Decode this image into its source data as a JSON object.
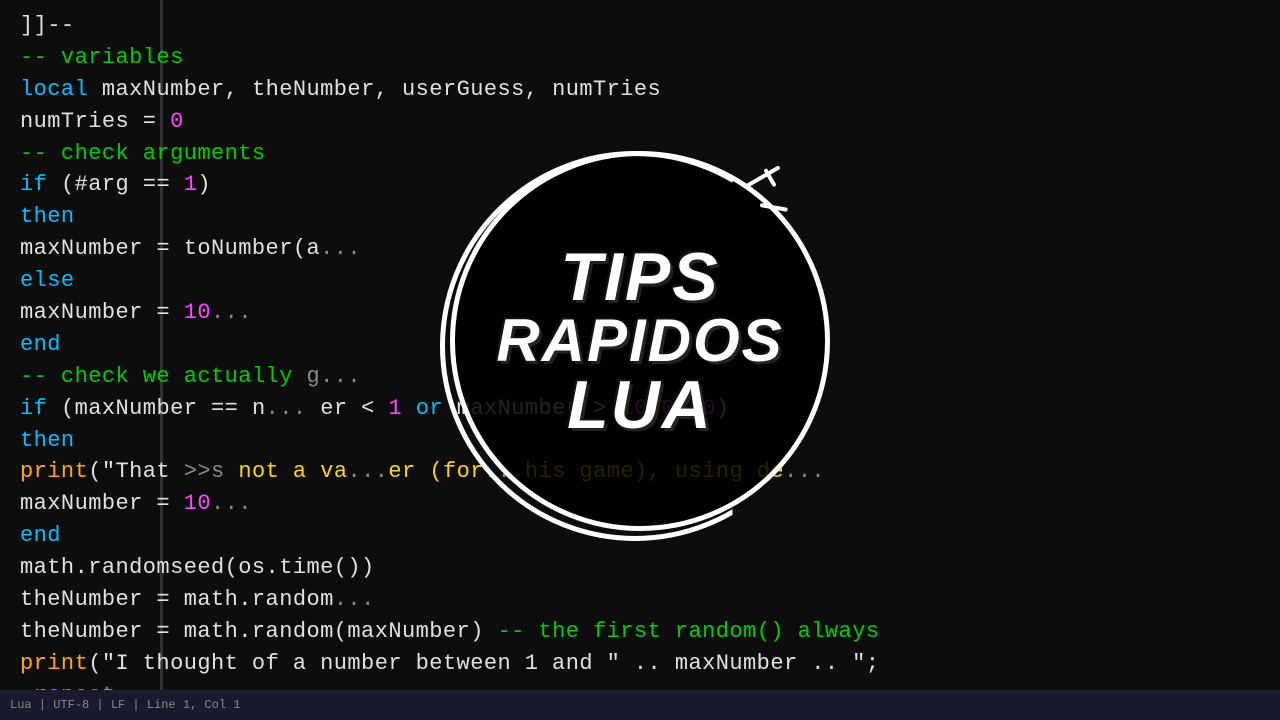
{
  "code": {
    "lines": [
      {
        "id": "l1",
        "html": "<span class='c-white'>]]--</span>"
      },
      {
        "id": "l2",
        "html": ""
      },
      {
        "id": "l3",
        "html": "<span class='c-comment'>-- variables</span>"
      },
      {
        "id": "l4",
        "html": "<span class='c-kw'>local</span> <span class='c-white'>maxNumber, theNumber, userGuess, numTries</span>"
      },
      {
        "id": "l5",
        "html": ""
      },
      {
        "id": "l6",
        "html": "<span class='c-white'>numTries</span> <span class='c-white'>=</span> <span class='c-num'>0</span>"
      },
      {
        "id": "l7",
        "html": ""
      },
      {
        "id": "l8",
        "html": "<span class='c-comment'>-- check arguments</span>"
      },
      {
        "id": "l9",
        "html": "<span class='c-kw'>if</span> <span class='c-white'>(#arg ==</span> <span class='c-num'>1</span><span class='c-white'>)</span>"
      },
      {
        "id": "l10",
        "html": "<span class='c-kw'>then</span>"
      },
      {
        "id": "l11",
        "html": "    <span class='c-white'>maxNumber = toNumber(a</span><span class='c-dim'>...</span>"
      },
      {
        "id": "l12",
        "html": "<span class='c-kw'>else</span>"
      },
      {
        "id": "l13",
        "html": "    <span class='c-white'>maxNumber =</span> <span class='c-num'>10</span><span class='c-dim'>...</span>"
      },
      {
        "id": "l14",
        "html": "<span class='c-kw'>end</span>"
      },
      {
        "id": "l15",
        "html": "<span class='c-comment'>-- check we actually</span> <span class='c-dim'>g...</span>"
      },
      {
        "id": "l16",
        "html": "<span class='c-kw'>if</span> <span class='c-white'>(maxNumber == n</span><span class='c-dim'>...</span> <span class='c-white'>er &lt;</span> <span class='c-num'>1</span> <span class='c-kw'>or</span> <span class='c-white'>maxNumber &gt;</span> <span class='c-num'>1000000</span><span class='c-white'>)</span>"
      },
      {
        "id": "l17",
        "html": "<span class='c-kw'>then</span>"
      },
      {
        "id": "l18",
        "html": "    <span class='c-fn'>print</span><span class='c-white'>(\"That</span> <span class='c-dim'>&gt;&gt;s</span> <span class='c-yellow'>not a va</span><span class='c-dim'>...</span><span class='c-yellow'>er (for</span><span class='c-dim'>...</span><span class='c-yellow'>his game), using de</span><span class='c-dim'>...</span>"
      },
      {
        "id": "l19",
        "html": "    <span class='c-white'>maxNumber =</span> <span class='c-num'>10</span><span class='c-dim'>...</span>"
      },
      {
        "id": "l20",
        "html": "<span class='c-kw'>end</span>"
      },
      {
        "id": "l21",
        "html": ""
      },
      {
        "id": "l22",
        "html": ""
      },
      {
        "id": "l23",
        "html": "<span class='c-white'>math.randomseed(os.time())</span>"
      },
      {
        "id": "l24",
        "html": "<span class='c-white'>theNumber = math.random</span><span class='c-dim'>...</span>"
      },
      {
        "id": "l25",
        "html": "<span class='c-white'>theNumber = math.random(maxNumber)</span> <span class='c-comment'>-- the first random() always</span>"
      },
      {
        "id": "l26",
        "html": "<span class='c-fn'>print</span><span class='c-white'>(\"I thought of a number between 1 and \" .. maxNumber .. \";</span>"
      },
      {
        "id": "l27",
        "html": ""
      },
      {
        "id": "l28",
        "html": "<span class='c-kw'>•repeat</span>"
      }
    ]
  },
  "logo": {
    "line1": "TIPS",
    "line2": "RAPIDOS",
    "line3": "LUA"
  },
  "bottomBar": {
    "text": "Lua  |  UTF-8  |  LF  |  Line 1, Col 1"
  }
}
